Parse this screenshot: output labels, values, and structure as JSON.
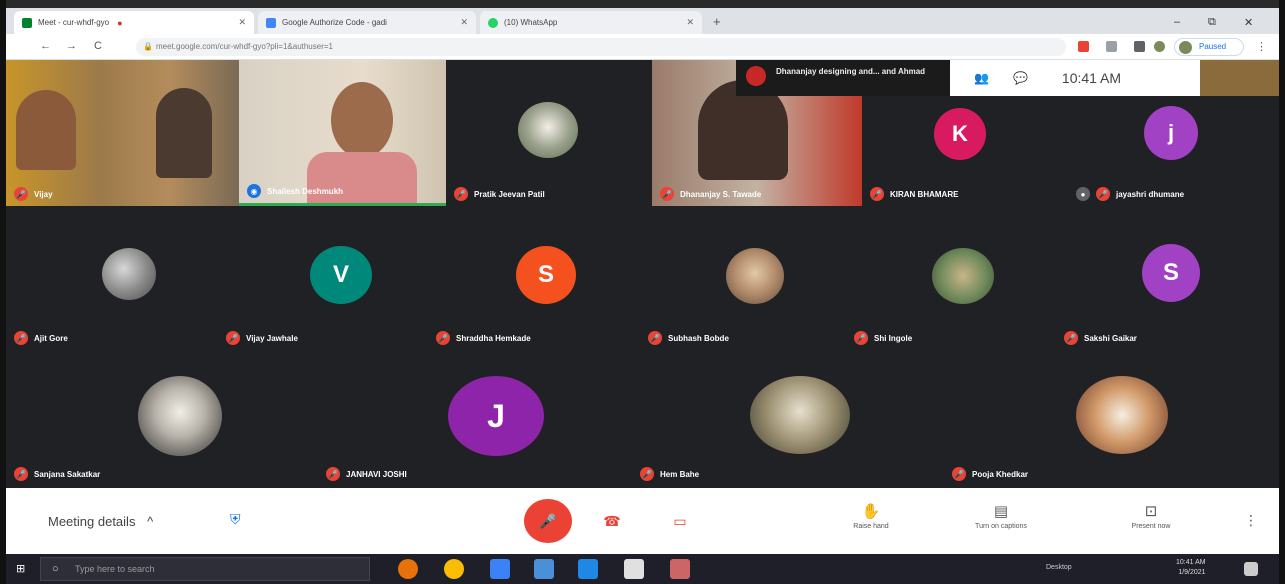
{
  "browser": {
    "tabs": [
      {
        "title": "Meet - cur-whdf-gyo"
      },
      {
        "title": "Google Authorize Code - gadi"
      },
      {
        "title": "(10) WhatsApp"
      }
    ],
    "address": "meet.google.com/cur-whdf-gyo?pli=1&authuser=1",
    "profile_label": "Paused",
    "window_controls": {
      "minimize": "–",
      "maximize": "⧉",
      "close": "✕"
    },
    "new_tab": "+",
    "nav": {
      "back": "←",
      "forward": "→",
      "reload": "C"
    }
  },
  "meet": {
    "clock": "10:41 AM",
    "presenting_banner": "Dhananjay designing and... and Ahmad",
    "participants_row1": [
      {
        "name": "Vijay",
        "type": "video"
      },
      {
        "name": "Shailesh Deshmukh",
        "type": "video"
      },
      {
        "name": "Pratik Jeevan Patil",
        "type": "photo"
      },
      {
        "name": "Dhananjay S. Tawade",
        "type": "video"
      },
      {
        "name": "KIRAN BHAMARE",
        "type": "letter",
        "letter": "K",
        "color": "#d81b60"
      },
      {
        "name": "jayashri dhumane",
        "type": "letter",
        "letter": "j",
        "color": "#a142c4"
      }
    ],
    "participants_row2": [
      {
        "name": "Ajit Gore",
        "type": "photo"
      },
      {
        "name": "Vijay Jawhale",
        "type": "letter",
        "letter": "V",
        "color": "#00897b"
      },
      {
        "name": "Shraddha Hemkade",
        "type": "letter",
        "letter": "S",
        "color": "#f4511e"
      },
      {
        "name": "Subhash Bobde",
        "type": "photo"
      },
      {
        "name": "Shi Ingole",
        "type": "photo"
      },
      {
        "name": "Sakshi Gaikar",
        "type": "letter",
        "letter": "S",
        "color": "#a142c4"
      }
    ],
    "participants_row3": [
      {
        "name": "Sanjana Sakatkar",
        "type": "photo"
      },
      {
        "name": "JANHAVI JOSHI",
        "type": "letter",
        "letter": "J",
        "color": "#8e24aa"
      },
      {
        "name": "Hem Bahe",
        "type": "photo"
      },
      {
        "name": "Pooja Khedkar",
        "type": "photo"
      }
    ]
  },
  "controls": {
    "meeting_details": "Meeting details",
    "chevron": "^",
    "raise_hand": "Raise hand",
    "captions": "Turn on captions",
    "present": "Present now",
    "more": "⋮"
  },
  "taskbar": {
    "search_placeholder": "Type here to search",
    "tray": "Desktop",
    "time": "10:41 AM",
    "date": "1/9/2021"
  },
  "colors": {
    "stage": "#202124",
    "mute_badge": "#ea4335",
    "end_call": "#ea4335",
    "accent": "#1a73e8"
  },
  "icons": [
    "back-icon",
    "forward-icon",
    "reload-icon",
    "lock-icon",
    "shield-icon",
    "mic-off-icon",
    "end-call-icon",
    "camera-off-icon",
    "raise-hand-icon",
    "captions-icon",
    "present-icon",
    "more-icon",
    "windows-start-icon",
    "search-icon"
  ]
}
